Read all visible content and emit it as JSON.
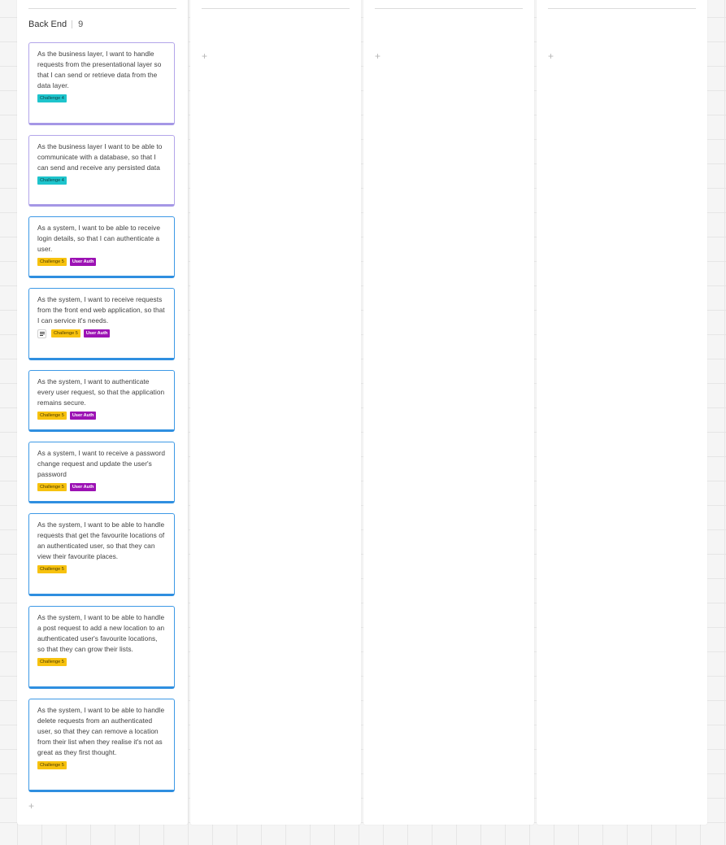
{
  "column": {
    "title": "Back End",
    "count": "9",
    "add_symbol": "+"
  },
  "empty_columns": [
    {
      "add_symbol": "+"
    },
    {
      "add_symbol": "+"
    },
    {
      "add_symbol": "+"
    }
  ],
  "tag_colors": {
    "Challenge 4": "#1ec4cc",
    "Challenge 5": "#f7c20f",
    "User Auth": "#9c12b4"
  },
  "cards": [
    {
      "text": "As the business layer, I want to handle requests from the presentational layer so that I can send  or retrieve data from the data layer.",
      "tags": [
        {
          "label": "Challenge 4",
          "color": "cyan"
        }
      ]
    },
    {
      "text": "As the business layer I want to be able to communicate with a database, so that I can send and receive any persisted data",
      "tags": [
        {
          "label": "Challenge 4",
          "color": "cyan"
        }
      ]
    },
    {
      "text": "As a system, I want to be able to receive login details, so that I can authenticate a user.",
      "tags": [
        {
          "label": "Challenge 5",
          "color": "yellow"
        },
        {
          "label": "User Auth",
          "color": "purple"
        }
      ]
    },
    {
      "text": "As the system, I want to receive requests from the front end web application, so that I can service it's needs.",
      "has_note": true,
      "tags": [
        {
          "label": "Challenge 5",
          "color": "yellow"
        },
        {
          "label": "User Auth",
          "color": "purple"
        }
      ]
    },
    {
      "text": "As the system, I want to authenticate every user request, so that the application remains secure.",
      "tags": [
        {
          "label": "Challenge 5",
          "color": "yellow"
        },
        {
          "label": "User Auth",
          "color": "purple"
        }
      ]
    },
    {
      "text": "As a system, I want to receive a password change request and update the user's password",
      "tags": [
        {
          "label": "Challenge 5",
          "color": "yellow"
        },
        {
          "label": "User Auth",
          "color": "purple"
        }
      ]
    },
    {
      "text": "As the system, I want to be able to handle requests that get the favourite locations of an authenticated user, so that they can view their favourite places.",
      "tags": [
        {
          "label": "Challenge 5",
          "color": "yellow"
        }
      ]
    },
    {
      "text": "As the system, I want to be able to handle a post request to add a new location to an authenticated user's favourite locations, so that they can grow their lists.",
      "tags": [
        {
          "label": "Challenge 5",
          "color": "yellow"
        }
      ]
    },
    {
      "text": "As the system, I want to be able to handle delete requests from an authenticated user, so that they can remove a location from their list when they realise it's not as great as they first thought.",
      "tags": [
        {
          "label": "Challenge 5",
          "color": "yellow"
        }
      ]
    }
  ]
}
